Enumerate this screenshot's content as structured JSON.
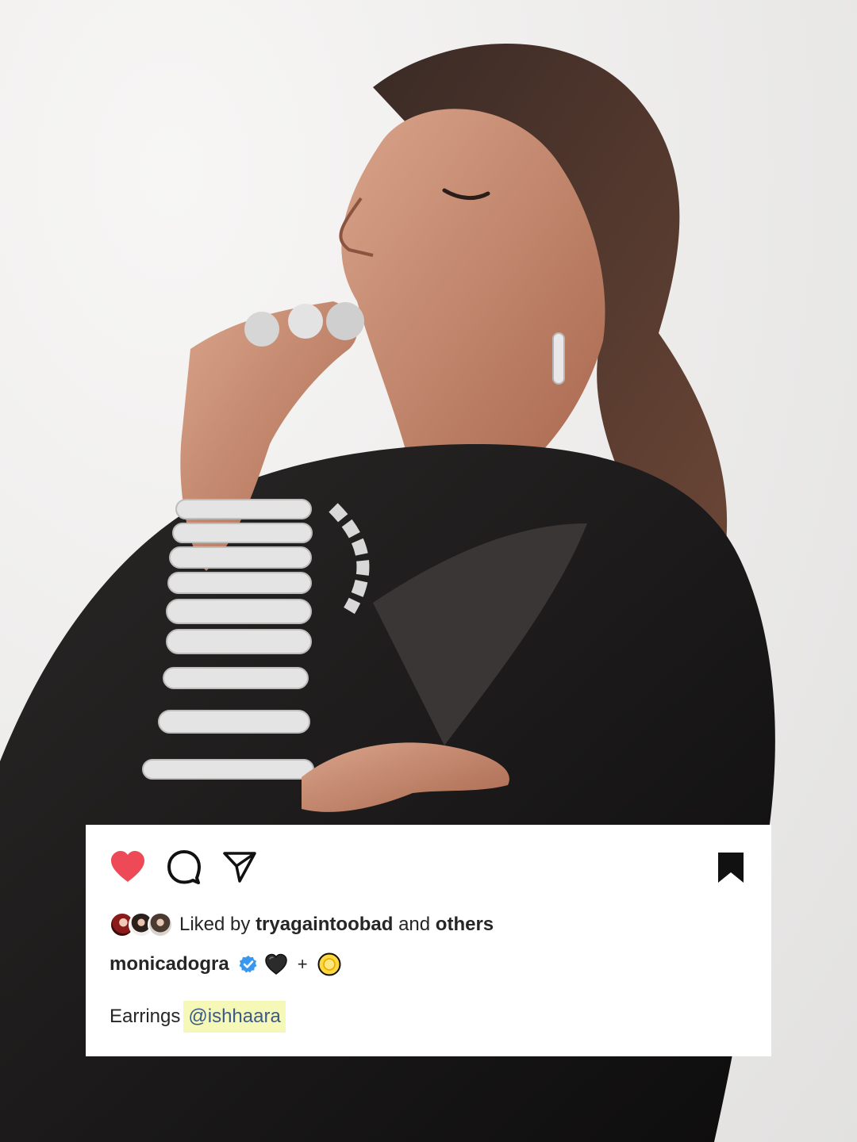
{
  "post": {
    "actions": {
      "like_icon": "heart-icon",
      "comment_icon": "comment-icon",
      "share_icon": "send-icon",
      "save_icon": "bookmark-icon",
      "like_color": "#ed4956"
    },
    "likes": {
      "prefix": "Liked by",
      "user": "tryagaintoobad",
      "connector": "and",
      "suffix": "others"
    },
    "author": {
      "username": "monicadogra",
      "verified_icon": "verified-badge-icon",
      "emoji_1": "black-heart-emoji",
      "plus": "+",
      "emoji_2": "sun-emoji"
    },
    "caption": {
      "text": "Earrings",
      "mention": "@ishhaara"
    }
  }
}
